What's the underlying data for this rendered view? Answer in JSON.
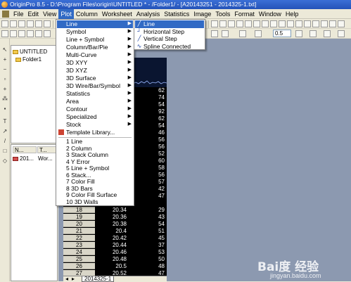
{
  "window": {
    "title": "OriginPro 8.5 - D:\\Program Files\\origin\\UNTITLED * - /Folder1/ - [A20143251 - 2014325-1.txt]"
  },
  "menubar": [
    "File",
    "Edit",
    "View",
    "Plot",
    "Column",
    "Worksheet",
    "Analysis",
    "Statistics",
    "Image",
    "Tools",
    "Format",
    "Window",
    "Help"
  ],
  "toolbar": {
    "width_value": "0.5"
  },
  "project": {
    "root": "UNTITLED",
    "folder": "Folder1"
  },
  "file_list": {
    "headers": [
      "N...",
      "T..."
    ],
    "items": [
      {
        "name": "201...",
        "type": "Wor..."
      }
    ]
  },
  "plot_menu": {
    "items": [
      {
        "label": "Line",
        "submenu": true,
        "highlighted": true
      },
      {
        "label": "Symbol",
        "submenu": true
      },
      {
        "label": "Line + Symbol",
        "submenu": true
      },
      {
        "label": "Column/Bar/Pie",
        "submenu": true
      },
      {
        "label": "Multi-Curve",
        "submenu": true
      },
      {
        "label": "3D XYY",
        "submenu": true
      },
      {
        "label": "3D XYZ",
        "submenu": true
      },
      {
        "label": "3D Surface",
        "submenu": true
      },
      {
        "label": "3D Wire/Bar/Symbol",
        "submenu": true
      },
      {
        "label": "Statistics",
        "submenu": true
      },
      {
        "label": "Area",
        "submenu": true
      },
      {
        "label": "Contour",
        "submenu": true
      },
      {
        "label": "Specialized",
        "submenu": true
      },
      {
        "label": "Stock",
        "submenu": true
      },
      {
        "label": "Template Library...",
        "submenu": false,
        "separator_after": true
      },
      {
        "label": "1 Line"
      },
      {
        "label": "2 Column"
      },
      {
        "label": "3 Stack Column"
      },
      {
        "label": "4 Y Error"
      },
      {
        "label": "5 Line + Symbol"
      },
      {
        "label": "6 Stack..."
      },
      {
        "label": "7 Color Fill"
      },
      {
        "label": "8 3D Bars"
      },
      {
        "label": "9 Color Fill Surface"
      },
      {
        "label": "10 3D Walls"
      }
    ]
  },
  "line_submenu": [
    {
      "label": "Line",
      "icon": "line-plot-icon",
      "highlighted": true
    },
    {
      "label": "Horizontal Step",
      "icon": "horizontal-step-icon"
    },
    {
      "label": "Vertical Step",
      "icon": "vertical-step-icon"
    },
    {
      "label": "Spline Connected",
      "icon": "spline-icon"
    }
  ],
  "worksheet": {
    "col_b_values_top": [
      "62",
      "74",
      "54",
      "92",
      "62",
      "54",
      "46",
      "56",
      "56",
      "52",
      "60",
      "58",
      "56",
      "57",
      "42",
      "47"
    ],
    "rows": [
      {
        "row": "18",
        "a": "20.34",
        "b": "29"
      },
      {
        "row": "19",
        "a": "20.36",
        "b": "43"
      },
      {
        "row": "20",
        "a": "20.38",
        "b": "54"
      },
      {
        "row": "21",
        "a": "20.4",
        "b": "51"
      },
      {
        "row": "22",
        "a": "20.42",
        "b": "45"
      },
      {
        "row": "23",
        "a": "20.44",
        "b": "37"
      },
      {
        "row": "24",
        "a": "20.46",
        "b": "53"
      },
      {
        "row": "25",
        "a": "20.48",
        "b": "50"
      },
      {
        "row": "26",
        "a": "20.5",
        "b": "48"
      },
      {
        "row": "27",
        "a": "20.52",
        "b": "47"
      }
    ],
    "sheet_tab": "2014325-1"
  },
  "watermark": {
    "main": "Bai度 经验",
    "sub": "jingyan.baidu.com"
  }
}
